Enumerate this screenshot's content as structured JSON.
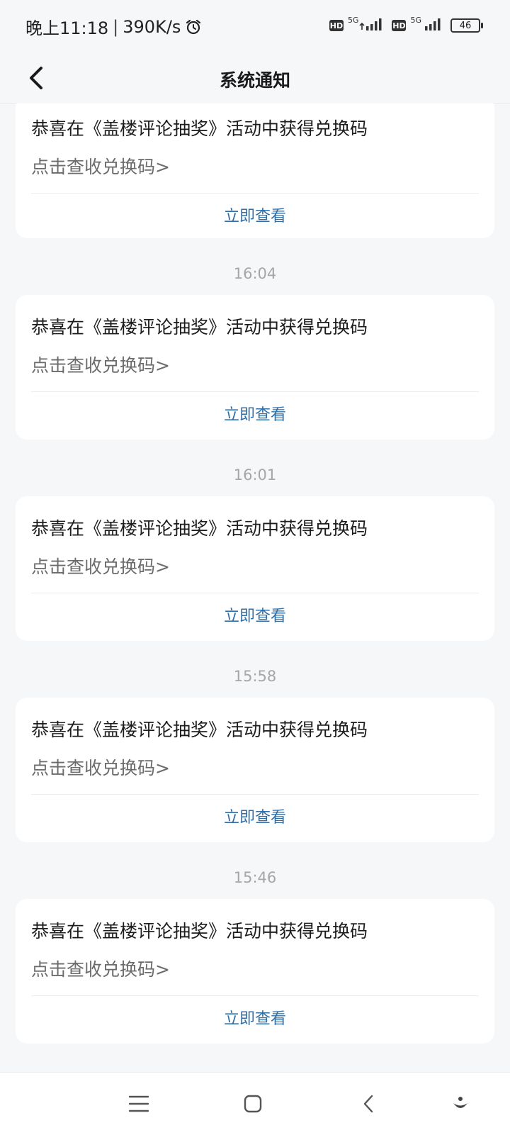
{
  "status_bar": {
    "time": "晚上11:18",
    "speed": "390K/s",
    "net1_hd": "HD",
    "net1_label": "5G",
    "net2_hd": "HD",
    "net2_label": "5G",
    "battery": "46"
  },
  "header": {
    "title": "系统通知"
  },
  "notifications": [
    {
      "time": "",
      "title": "恭喜在《盖楼评论抽奖》活动中获得兑换码",
      "subtitle": "点击查收兑换码>",
      "action": "立即查看"
    },
    {
      "time": "16:04",
      "title": "恭喜在《盖楼评论抽奖》活动中获得兑换码",
      "subtitle": "点击查收兑换码>",
      "action": "立即查看"
    },
    {
      "time": "16:01",
      "title": "恭喜在《盖楼评论抽奖》活动中获得兑换码",
      "subtitle": "点击查收兑换码>",
      "action": "立即查看"
    },
    {
      "time": "15:58",
      "title": "恭喜在《盖楼评论抽奖》活动中获得兑换码",
      "subtitle": "点击查收兑换码>",
      "action": "立即查看"
    },
    {
      "time": "15:46",
      "title": "恭喜在《盖楼评论抽奖》活动中获得兑换码",
      "subtitle": "点击查收兑换码>",
      "action": "立即查看"
    }
  ],
  "icons": {
    "back": "chevron-left-icon",
    "alarm": "alarm-clock-icon",
    "menu": "menu-icon",
    "home": "home-icon",
    "nav_back": "back-icon",
    "assistant": "assistant-icon"
  },
  "colors": {
    "accent": "#2f6fa8",
    "background": "#f6f7f9",
    "card": "#ffffff"
  }
}
